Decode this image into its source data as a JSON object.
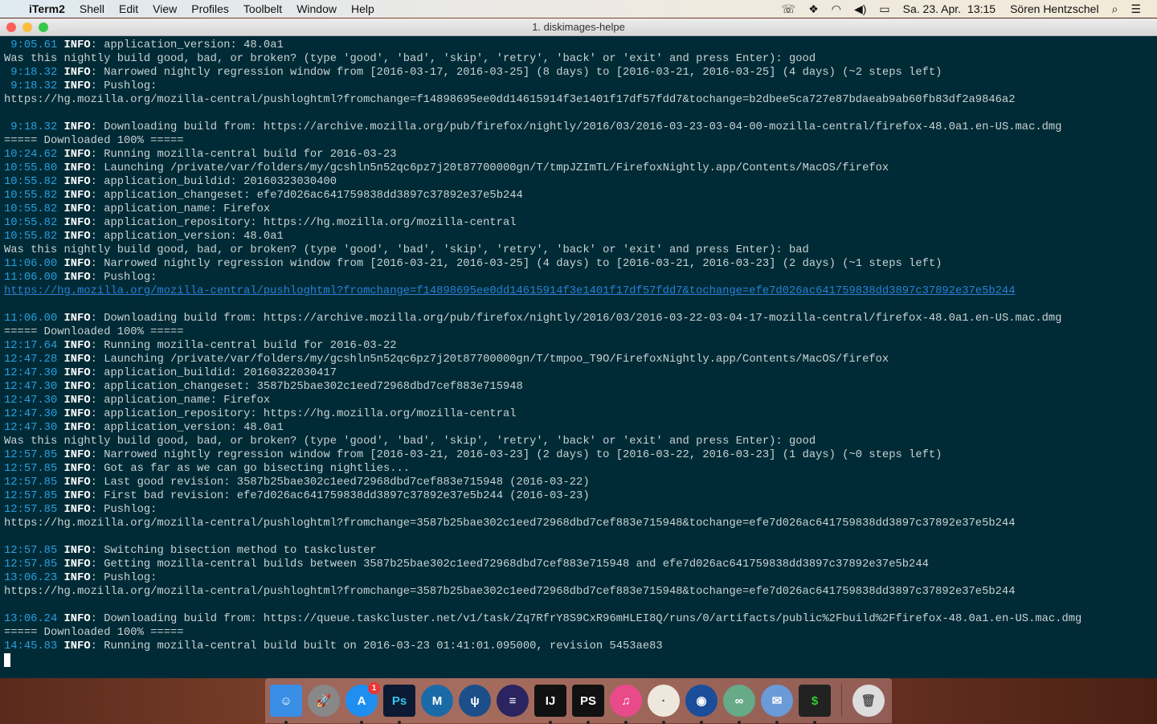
{
  "menubar": {
    "app": "iTerm2",
    "items": [
      "Shell",
      "Edit",
      "View",
      "Profiles",
      "Toolbelt",
      "Window",
      "Help"
    ],
    "date": "Sa. 23. Apr.",
    "time": "13:15",
    "user": "Sören Hentzschel"
  },
  "window": {
    "title": "1. diskimages-helpe"
  },
  "terminal": {
    "level": "INFO",
    "lines": [
      {
        "t": " 9:05.61",
        "m": "application_version: 48.0a1"
      },
      {
        "x": "Was this nightly build good, bad, or broken? (type 'good', 'bad', 'skip', 'retry', 'back' or 'exit' and press Enter): good"
      },
      {
        "t": " 9:18.32",
        "m": "Narrowed nightly regression window from [2016-03-17, 2016-03-25] (8 days) to [2016-03-21, 2016-03-25] (4 days) (~2 steps left)"
      },
      {
        "t": " 9:18.32",
        "m": "Pushlog:"
      },
      {
        "x": "https://hg.mozilla.org/mozilla-central/pushloghtml?fromchange=f14898695ee0dd14615914f3e1401f17df57fdd7&tochange=b2dbee5ca727e87bdaeab9ab60fb83df2a9846a2"
      },
      {
        "x": ""
      },
      {
        "t": " 9:18.32",
        "m": "Downloading build from: https://archive.mozilla.org/pub/firefox/nightly/2016/03/2016-03-23-03-04-00-mozilla-central/firefox-48.0a1.en-US.mac.dmg"
      },
      {
        "x": "===== Downloaded 100% ====="
      },
      {
        "t": "10:24.62",
        "m": "Running mozilla-central build for 2016-03-23"
      },
      {
        "t": "10:55.80",
        "m": "Launching /private/var/folders/my/gcshln5n52qc6pz7j20t87700000gn/T/tmpJZImTL/FirefoxNightly.app/Contents/MacOS/firefox"
      },
      {
        "t": "10:55.82",
        "m": "application_buildid: 20160323030400"
      },
      {
        "t": "10:55.82",
        "m": "application_changeset: efe7d026ac641759838dd3897c37892e37e5b244"
      },
      {
        "t": "10:55.82",
        "m": "application_name: Firefox"
      },
      {
        "t": "10:55.82",
        "m": "application_repository: https://hg.mozilla.org/mozilla-central"
      },
      {
        "t": "10:55.82",
        "m": "application_version: 48.0a1"
      },
      {
        "x": "Was this nightly build good, bad, or broken? (type 'good', 'bad', 'skip', 'retry', 'back' or 'exit' and press Enter): bad"
      },
      {
        "t": "11:06.00",
        "m": "Narrowed nightly regression window from [2016-03-21, 2016-03-25] (4 days) to [2016-03-21, 2016-03-23] (2 days) (~1 steps left)"
      },
      {
        "t": "11:06.00",
        "m": "Pushlog:"
      },
      {
        "l": "https://hg.mozilla.org/mozilla-central/pushloghtml?fromchange=f14898695ee0dd14615914f3e1401f17df57fdd7&tochange=efe7d026ac641759838dd3897c37892e37e5b244"
      },
      {
        "x": ""
      },
      {
        "t": "11:06.00",
        "m": "Downloading build from: https://archive.mozilla.org/pub/firefox/nightly/2016/03/2016-03-22-03-04-17-mozilla-central/firefox-48.0a1.en-US.mac.dmg"
      },
      {
        "x": "===== Downloaded 100% ====="
      },
      {
        "t": "12:17.64",
        "m": "Running mozilla-central build for 2016-03-22"
      },
      {
        "t": "12:47.28",
        "m": "Launching /private/var/folders/my/gcshln5n52qc6pz7j20t87700000gn/T/tmpoo_T9O/FirefoxNightly.app/Contents/MacOS/firefox"
      },
      {
        "t": "12:47.30",
        "m": "application_buildid: 20160322030417"
      },
      {
        "t": "12:47.30",
        "m": "application_changeset: 3587b25bae302c1eed72968dbd7cef883e715948"
      },
      {
        "t": "12:47.30",
        "m": "application_name: Firefox"
      },
      {
        "t": "12:47.30",
        "m": "application_repository: https://hg.mozilla.org/mozilla-central"
      },
      {
        "t": "12:47.30",
        "m": "application_version: 48.0a1"
      },
      {
        "x": "Was this nightly build good, bad, or broken? (type 'good', 'bad', 'skip', 'retry', 'back' or 'exit' and press Enter): good"
      },
      {
        "t": "12:57.85",
        "m": "Narrowed nightly regression window from [2016-03-21, 2016-03-23] (2 days) to [2016-03-22, 2016-03-23] (1 days) (~0 steps left)"
      },
      {
        "t": "12:57.85",
        "m": "Got as far as we can go bisecting nightlies..."
      },
      {
        "t": "12:57.85",
        "m": "Last good revision: 3587b25bae302c1eed72968dbd7cef883e715948 (2016-03-22)"
      },
      {
        "t": "12:57.85",
        "m": "First bad revision: efe7d026ac641759838dd3897c37892e37e5b244 (2016-03-23)"
      },
      {
        "t": "12:57.85",
        "m": "Pushlog:"
      },
      {
        "x": "https://hg.mozilla.org/mozilla-central/pushloghtml?fromchange=3587b25bae302c1eed72968dbd7cef883e715948&tochange=efe7d026ac641759838dd3897c37892e37e5b244"
      },
      {
        "x": ""
      },
      {
        "t": "12:57.85",
        "m": "Switching bisection method to taskcluster"
      },
      {
        "t": "12:57.85",
        "m": "Getting mozilla-central builds between 3587b25bae302c1eed72968dbd7cef883e715948 and efe7d026ac641759838dd3897c37892e37e5b244"
      },
      {
        "t": "13:06.23",
        "m": "Pushlog:"
      },
      {
        "x": "https://hg.mozilla.org/mozilla-central/pushloghtml?fromchange=3587b25bae302c1eed72968dbd7cef883e715948&tochange=efe7d026ac641759838dd3897c37892e37e5b244"
      },
      {
        "x": ""
      },
      {
        "t": "13:06.24",
        "m": "Downloading build from: https://queue.taskcluster.net/v1/task/Zq7RfrY8S9CxR96mHLEI8Q/runs/0/artifacts/public%2Fbuild%2Ffirefox-48.0a1.en-US.mac.dmg"
      },
      {
        "x": "===== Downloaded 100% ====="
      },
      {
        "t": "14:45.83",
        "m": "Running mozilla-central build built on 2016-03-23 01:41:01.095000, revision 5453ae83"
      }
    ]
  },
  "dock": {
    "items": [
      {
        "name": "finder",
        "label": "☺",
        "color": "#3a8ee6",
        "running": true
      },
      {
        "name": "launchpad",
        "label": "🚀",
        "color": "#888",
        "running": false
      },
      {
        "name": "app-store",
        "label": "A",
        "color": "#1e8ff0",
        "running": true,
        "badge": "1"
      },
      {
        "name": "photoshop",
        "label": "Ps",
        "color": "#0d1a33",
        "running": true
      },
      {
        "name": "mamp",
        "label": "M",
        "color": "#1b6aa8",
        "running": false
      },
      {
        "name": "sourcetree",
        "label": "ψ",
        "color": "#1c4f8a",
        "running": false
      },
      {
        "name": "eclipse",
        "label": "≡",
        "color": "#2b2460",
        "running": false
      },
      {
        "name": "intellij",
        "label": "IJ",
        "color": "#111",
        "running": true
      },
      {
        "name": "phpstorm",
        "label": "PS",
        "color": "#111",
        "running": true
      },
      {
        "name": "itunes",
        "label": "♫",
        "color": "#e94b8a",
        "running": true
      },
      {
        "name": "egg",
        "label": "·",
        "color": "#eee8dc",
        "running": true
      },
      {
        "name": "firefox-nightly",
        "label": "◉",
        "color": "#1a4d9a",
        "running": true
      },
      {
        "name": "binoculars",
        "label": "∞",
        "color": "#6a8",
        "running": true
      },
      {
        "name": "mail",
        "label": "✉",
        "color": "#6a9ad8",
        "running": true
      },
      {
        "name": "terminal",
        "label": "$",
        "color": "#222",
        "running": true
      },
      {
        "name": "trash",
        "label": "🗑",
        "color": "#ddd",
        "running": false
      }
    ]
  },
  "colors": {
    "terminal_bg": "#002b36",
    "timestamp": "#2a9fe0",
    "link": "#2a7fd4"
  }
}
